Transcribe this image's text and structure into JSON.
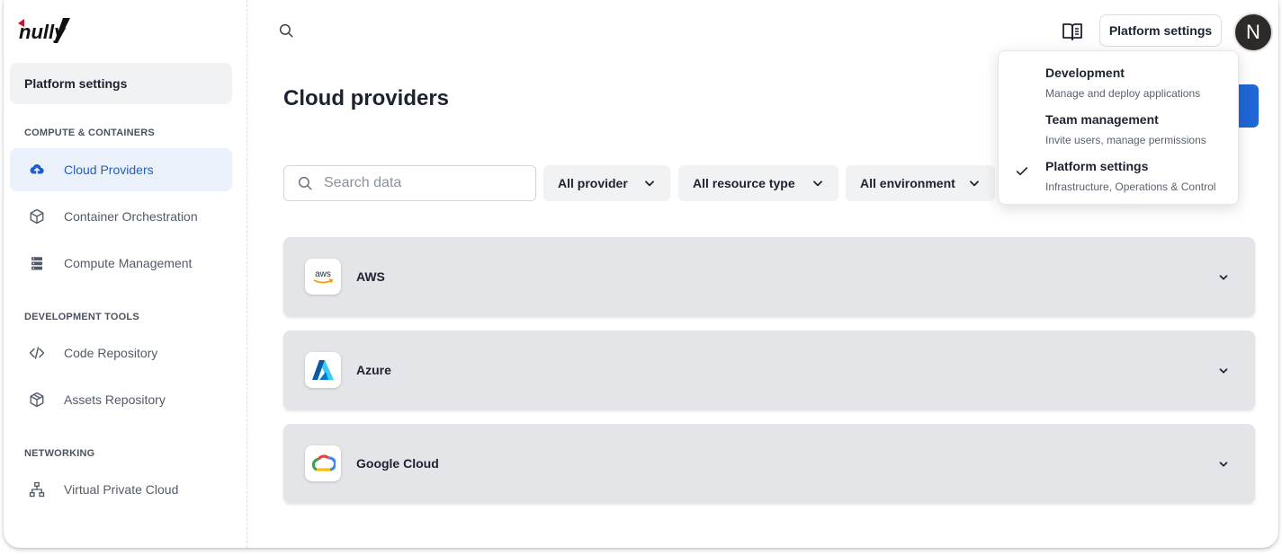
{
  "brand": {
    "logo_text": "nully"
  },
  "sidebar": {
    "context_card": "Platform settings",
    "sections": [
      {
        "title": "COMPUTE & CONTAINERS",
        "items": [
          {
            "label": "Cloud Providers",
            "icon": "cloud-upload-icon",
            "active": true
          },
          {
            "label": "Container Orchestration",
            "icon": "cube-icon",
            "active": false
          },
          {
            "label": "Compute Management",
            "icon": "server-icon",
            "active": false
          }
        ]
      },
      {
        "title": "DEVELOPMENT TOOLS",
        "items": [
          {
            "label": "Code Repository",
            "icon": "code-icon",
            "active": false
          },
          {
            "label": "Assets Repository",
            "icon": "package-icon",
            "active": false
          }
        ]
      },
      {
        "title": "NETWORKING",
        "items": [
          {
            "label": "Virtual Private Cloud",
            "icon": "network-icon",
            "active": false
          }
        ]
      }
    ]
  },
  "header": {
    "context_button": "Platform settings",
    "avatar_initial": "N"
  },
  "main": {
    "title": "Cloud providers",
    "search": {
      "placeholder": "Search data",
      "value": ""
    },
    "filters": [
      "All provider",
      "All resource type",
      "All environment"
    ],
    "providers": [
      {
        "name": "AWS",
        "logo": "aws-logo"
      },
      {
        "name": "Azure",
        "logo": "azure-logo"
      },
      {
        "name": "Google Cloud",
        "logo": "google-cloud-logo"
      }
    ]
  },
  "context_menu": {
    "items": [
      {
        "title": "Development",
        "subtitle": "Manage and deploy applications",
        "selected": false
      },
      {
        "title": "Team management",
        "subtitle": "Invite users, manage permissions",
        "selected": false
      },
      {
        "title": "Platform settings",
        "subtitle": "Infrastructure, Operations & Control",
        "selected": true
      }
    ]
  },
  "colors": {
    "accent": "#1f66d6",
    "active_bg": "#eaf1fb",
    "row_bg": "#e3e5e8"
  }
}
